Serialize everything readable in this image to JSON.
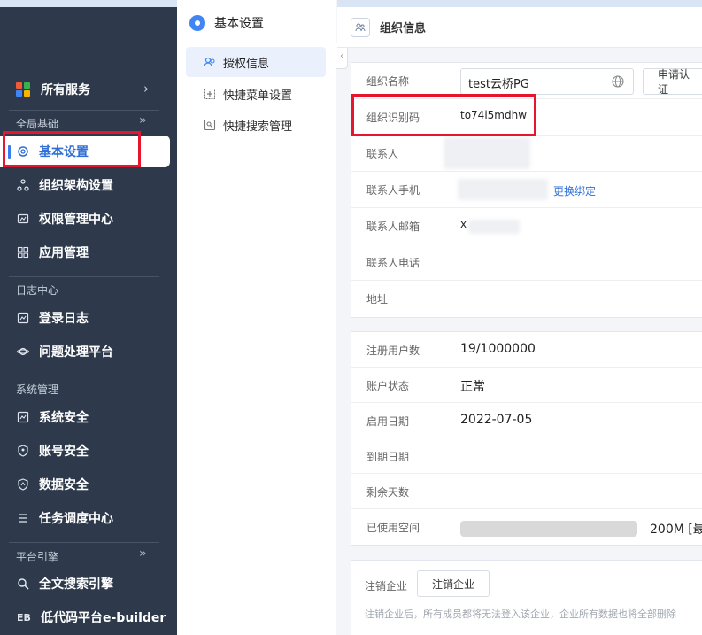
{
  "sidebar": {
    "all_services": "所有服务",
    "sections": [
      {
        "title": "全局基础",
        "items": [
          "基本设置",
          "组织架构设置",
          "权限管理中心",
          "应用管理"
        ]
      },
      {
        "title": "日志中心",
        "items": [
          "登录日志",
          "问题处理平台"
        ]
      },
      {
        "title": "系统管理",
        "items": [
          "系统安全",
          "账号安全",
          "数据安全",
          "任务调度中心"
        ]
      },
      {
        "title": "平台引擎",
        "items": [
          "全文搜索引擎",
          "低代码平台e-builder"
        ]
      }
    ],
    "eb_prefix": "EB",
    "active_item": "基本设置",
    "colors": {
      "bg": "#2e3a4b",
      "accent": "#2f6fd6",
      "highlight": "#e5162e"
    }
  },
  "subpanel": {
    "title": "基本设置",
    "items": [
      "授权信息",
      "快捷菜单设置",
      "快捷搜索管理"
    ],
    "active": "授权信息"
  },
  "content": {
    "title": "组织信息",
    "org": {
      "name_label": "组织名称",
      "name_value": "test云桥PG",
      "apply_button": "申请认证",
      "code_label": "组织识别码",
      "code_value": "to74i5mdhw",
      "contact_label": "联系人",
      "phone_label": "联系人手机",
      "change_binding": "更换绑定",
      "email_label": "联系人邮箱",
      "email_value": "x",
      "tel_label": "联系人电话",
      "address_label": "地址"
    },
    "account": {
      "users_label": "注册用户数",
      "users_value": "19/1000000",
      "status_label": "账户状态",
      "status_value": "正常",
      "start_label": "启用日期",
      "start_value": "2022-07-05",
      "expire_label": "到期日期",
      "remaining_label": "剩余天数",
      "space_label": "已使用空间",
      "space_value": "200M [最",
      "space_used_fraction": 0.0
    },
    "cancel": {
      "label": "注销企业",
      "button": "注销企业",
      "note": "注销企业后，所有成员都将无法登入该企业，企业所有数据也将全部删除"
    }
  }
}
